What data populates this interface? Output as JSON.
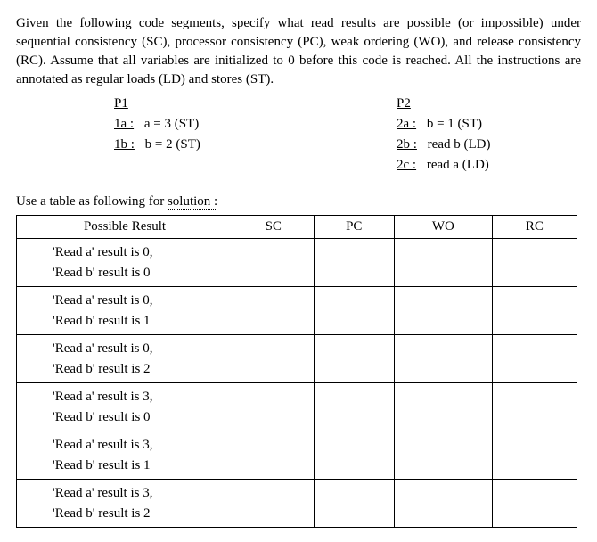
{
  "intro": "Given the following code segments, specify what read results are possible (or impossible) under sequential consistency (SC), processor consistency (PC), weak ordering (WO), and release consistency (RC). Assume that all variables are initialized to 0 before this code is reached. All the instructions are annotated as regular loads (LD) and stores (ST).",
  "segments": {
    "p1": {
      "header": "P1",
      "instructions": [
        {
          "label": "1a :",
          "body": "a = 3 (ST)"
        },
        {
          "label": "1b :",
          "body": "b = 2 (ST)"
        }
      ]
    },
    "p2": {
      "header": "P2",
      "instructions": [
        {
          "label": "2a :",
          "body": "b = 1 (ST)"
        },
        {
          "label": "2b :",
          "body": "read b (LD)"
        },
        {
          "label": "2c :",
          "body": "read a (LD)"
        }
      ]
    }
  },
  "solution_lead_prefix": "Use a table as following for ",
  "solution_lead_link": "solution :",
  "table": {
    "headers": {
      "result": "Possible Result",
      "sc": "SC",
      "pc": "PC",
      "wo": "WO",
      "rc": "RC"
    },
    "rows": [
      {
        "line1": "'Read a' result is 0,",
        "line2": "'Read b' result is 0"
      },
      {
        "line1": "'Read a' result is 0,",
        "line2": "'Read b' result is 1"
      },
      {
        "line1": "'Read a' result is 0,",
        "line2": "'Read b' result is 2"
      },
      {
        "line1": "'Read a' result is 3,",
        "line2": "'Read b' result is 0"
      },
      {
        "line1": "'Read a' result is 3,",
        "line2": "'Read b' result is 1"
      },
      {
        "line1": "'Read a' result is 3,",
        "line2": "'Read b' result is 2"
      }
    ]
  }
}
